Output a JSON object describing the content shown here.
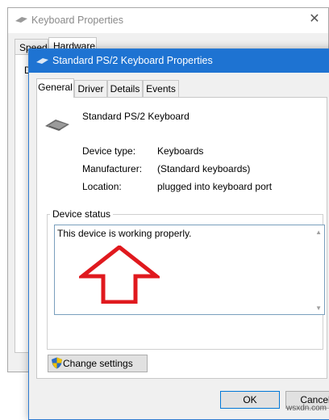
{
  "background_window": {
    "title": "Keyboard Properties",
    "tabs": [
      "Speed",
      "Hardware"
    ],
    "partial_letter": "D",
    "close_glyph": "✕"
  },
  "dialog": {
    "title": "Standard PS/2 Keyboard Properties",
    "tabs": [
      "General",
      "Driver",
      "Details",
      "Events"
    ],
    "active_tab": "General",
    "device_name": "Standard PS/2 Keyboard",
    "properties": [
      {
        "label": "Device type:",
        "value": "Keyboards"
      },
      {
        "label": "Manufacturer:",
        "value": "(Standard keyboards)"
      },
      {
        "label": "Location:",
        "value": "plugged into keyboard port"
      }
    ],
    "device_status": {
      "group_label": "Device status",
      "text": "This device is working properly."
    },
    "change_settings_label": "Change settings",
    "ok_label": "OK",
    "cancel_label": "Cancel"
  },
  "annotation": {
    "arrow_color": "#e0191e"
  },
  "colors": {
    "titlebar_active": "#1e73d2",
    "dialog_border": "#2c7bd2"
  },
  "watermark": "wsxdn.com"
}
